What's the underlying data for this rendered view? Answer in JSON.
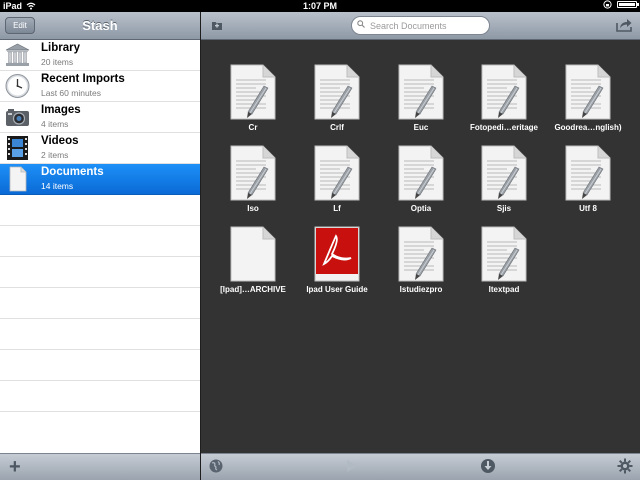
{
  "status_bar": {
    "device": "iPad",
    "time": "1:07 PM"
  },
  "sidebar": {
    "edit_label": "Edit",
    "title": "Stash",
    "items": [
      {
        "icon": "library-icon",
        "title": "Library",
        "subtitle": "20 items",
        "selected": false
      },
      {
        "icon": "clock-icon",
        "title": "Recent Imports",
        "subtitle": "Last 60 minutes",
        "selected": false
      },
      {
        "icon": "camera-icon",
        "title": "Images",
        "subtitle": "4 items",
        "selected": false
      },
      {
        "icon": "film-icon",
        "title": "Videos",
        "subtitle": "2 items",
        "selected": false
      },
      {
        "icon": "document-icon",
        "title": "Documents",
        "subtitle": "14 items",
        "selected": true
      }
    ],
    "add_icon": "plus-icon"
  },
  "toolbar": {
    "folder_icon": "folder-icon",
    "search_placeholder": "Search Documents",
    "share_icon": "share-icon"
  },
  "documents": [
    {
      "name": "Cr",
      "type": "text"
    },
    {
      "name": "Crlf",
      "type": "text"
    },
    {
      "name": "Euc",
      "type": "text"
    },
    {
      "name": "Fotopedi…eritage",
      "type": "text"
    },
    {
      "name": "Goodrea…nglish)",
      "type": "text"
    },
    {
      "name": "Iso",
      "type": "text"
    },
    {
      "name": "Lf",
      "type": "text"
    },
    {
      "name": "Optia",
      "type": "text"
    },
    {
      "name": "Sjis",
      "type": "text"
    },
    {
      "name": "Utf 8",
      "type": "text"
    },
    {
      "name": "[Ipad]…ARCHIVE",
      "type": "blank"
    },
    {
      "name": "Ipad User Guide",
      "type": "pdf"
    },
    {
      "name": "Istudiezpro",
      "type": "text"
    },
    {
      "name": "Itextpad",
      "type": "text"
    }
  ],
  "bottom_toolbar": {
    "icons": [
      "globe-icon",
      "play-icon",
      "download-icon",
      "gear-icon"
    ]
  },
  "colors": {
    "selection": "#0f77e5",
    "grid_background": "#333333",
    "pdf_red": "#c8100e"
  }
}
